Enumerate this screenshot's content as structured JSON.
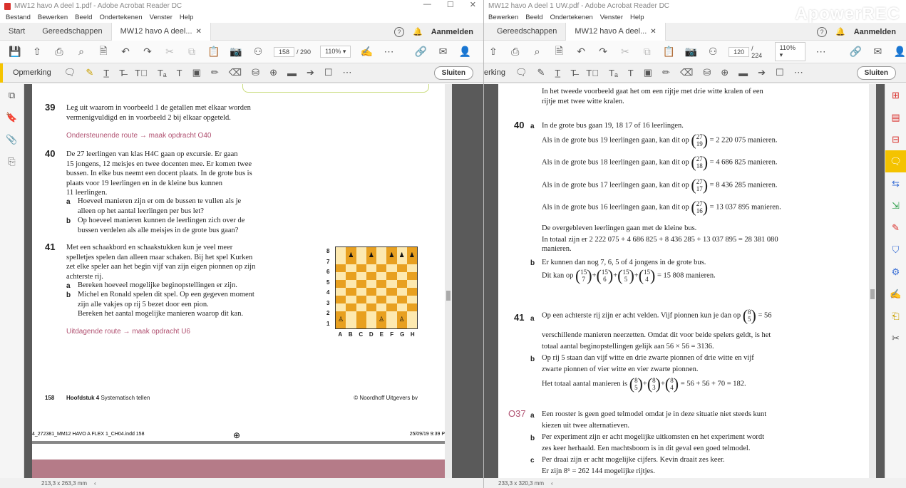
{
  "left": {
    "title": "MW12 havo A deel 1.pdf - Adobe Acrobat Reader DC",
    "menu": [
      "Bestand",
      "Bewerken",
      "Beeld",
      "Ondertekenen",
      "Venster",
      "Help"
    ],
    "tabs": {
      "start": "Start",
      "tools": "Gereedschappen",
      "doc": "MW12 havo A deel...",
      "signin": "Aanmelden"
    },
    "page_current": "158",
    "page_total": "/ 290",
    "zoom": "110%",
    "comment_label": "Opmerking",
    "close": "Sluiten",
    "size": "213,3 x 263,3 mm",
    "content": {
      "q39": "39",
      "q39_text": [
        "Leg uit waarom in voorbeeld 1 de getallen met elkaar worden",
        "vermenigvuldigd en in voorbeeld 2 bij elkaar opgeteld."
      ],
      "route1": "Ondersteunende route → maak opdracht O40",
      "q40": "40",
      "q40_text": [
        "De 27 leerlingen van klas H4C gaan op excursie. Er gaan",
        "15 jongens, 12 meisjes en twee docenten mee. Er komen twee",
        "bussen. In elke bus neemt een docent plaats. In de grote bus is",
        "plaats voor 19 leerlingen en in de kleine bus kunnen",
        "11 leerlingen."
      ],
      "q40a_l": "a",
      "q40a": [
        "Hoeveel manieren zijn er om de bussen te vullen als je",
        "alleen op het aantal leerlingen per bus let?"
      ],
      "q40b_l": "b",
      "q40b": [
        "Op hoeveel manieren kunnen de leerlingen zich over de",
        "bussen verdelen als alle meisjes in de grote bus gaan?"
      ],
      "q41": "41",
      "q41_text": [
        "Met een schaakbord en schaakstukken kun je veel meer",
        "spelletjes spelen dan alleen maar schaken. Bij het spel Kurken",
        "zet elke speler aan het begin vijf van zijn eigen pionnen op zijn",
        "achterste rij."
      ],
      "q41a_l": "a",
      "q41a": "Bereken hoeveel mogelijke beginopstellingen er zijn.",
      "q41b_l": "b",
      "q41b": [
        "Michel en Ronald spelen dit spel. Op een gegeven moment",
        "zijn alle vakjes op rij 5 bezet door een pion.",
        "Bereken het aantal mogelijke manieren waarop dit kan."
      ],
      "route2": "Uitdagende route → maak opdracht U6",
      "chess_ranks": [
        "8",
        "7",
        "6",
        "5",
        "4",
        "3",
        "2",
        "1"
      ],
      "chess_files": [
        "A",
        "B",
        "C",
        "D",
        "E",
        "F",
        "G",
        "H"
      ],
      "footer_page": "158",
      "footer_ch": "Hoofdstuk 4",
      "footer_title": "Systematisch tellen",
      "footer_pub": "© Noordhoff Uitgevers bv",
      "indd": "4_272381_MM12 HAVO A FLEX 1_CH04.indd   158",
      "indd_date": "25/09/19   9:39 P"
    }
  },
  "right": {
    "title": "MW12 havo A deel 1 UW.pdf - Adobe Acrobat Reader DC",
    "watermark": "ApowerREC",
    "menu": [
      "Bewerken",
      "Beeld",
      "Ondertekenen",
      "Venster",
      "Help"
    ],
    "tabs": {
      "tools": "Gereedschappen",
      "doc": "MW12 havo A deel...",
      "signin": "Aanmelden"
    },
    "page_current": "120",
    "page_total": "/ 224",
    "zoom": "110%",
    "comment_label": "erking",
    "close": "Sluiten",
    "size": "233,3 x 320,3 mm",
    "content": {
      "intro": [
        "In het tweede voorbeeld gaat het om een rijtje met drie witte kralen of een",
        "rijtje met twee witte kralen."
      ],
      "q40": "40",
      "a": "a",
      "l40a": "In de grote bus gaan 19, 18 17 of 16 leerlingen.",
      "bus_pre": [
        "Als in de grote bus 19 leerlingen gaan, kan dit op",
        "Als in de grote bus 18 leerlingen gaan, kan dit op",
        "Als in de grote bus 17 leerlingen gaan, kan dit op",
        "Als in de grote bus 16 leerlingen gaan, kan dit op"
      ],
      "bus_top": "27",
      "bus_bot": [
        "19",
        "18",
        "17",
        "16"
      ],
      "bus_res": [
        "= 2 220 075 manieren.",
        "= 4 686 825 manieren.",
        "= 8 436 285 manieren.",
        "= 13 037 895 manieren."
      ],
      "rest": [
        "De overgebleven leerlingen gaan met de kleine bus.",
        "In totaal zijn er 2 222 075 + 4 686 825 + 8 436 285 + 13 037 895 = 28 381 080",
        "manieren."
      ],
      "b": "b",
      "l40b": "Er kunnen dan nog 7, 6, 5 of 4 jongens in de grote bus.",
      "l40b2_pre": "Dit kan op",
      "l40b2_top": "15",
      "l40b2_bots": [
        "7",
        "6",
        "5",
        "4"
      ],
      "l40b2_res": "= 15 808 manieren.",
      "q41": "41",
      "l41a_pre": "Op een achterste rij zijn er acht velden. Vijf pionnen kun je dan op",
      "l41a_top": "8",
      "l41a_bot": "5",
      "l41a_res": "= 56",
      "l41a_more": [
        "verschillende manieren neerzetten. Omdat dit voor beide spelers geldt, is het",
        "totaal aantal beginopstellingen gelijk aan 56 × 56 = 3136."
      ],
      "l41b": [
        "Op rij 5 staan dan vijf witte en drie zwarte pionnen of drie witte en vijf",
        "zwarte pionnen of vier witte en vier zwarte pionnen."
      ],
      "l41b_pre": "Het totaal aantal manieren is",
      "l41b_top": "8",
      "l41b_bots": [
        "5",
        "3",
        "4"
      ],
      "l41b_res": "= 56 + 56 + 70 = 182.",
      "o37": "O37",
      "o37a": [
        "Een rooster is geen goed telmodel omdat je in deze situatie niet steeds kunt",
        "kiezen uit twee alternatieven."
      ],
      "o37b": [
        "Per experiment zijn er acht mogelijke uitkomsten en het experiment wordt",
        "zes keer herhaald. Een machtsboom is in dit geval een goed telmodel."
      ],
      "c": "c",
      "o37c": [
        "Per draai zijn er acht mogelijke cijfers. Kevin draait zes keer.",
        "Er zijn 8⁶ = 262 144 mogelijke rijtjes."
      ]
    }
  },
  "colors": {
    "accent": "#f4c300",
    "route": "#b05070",
    "chess_dark": "#e8a020",
    "chess_light": "#fde9b0"
  }
}
